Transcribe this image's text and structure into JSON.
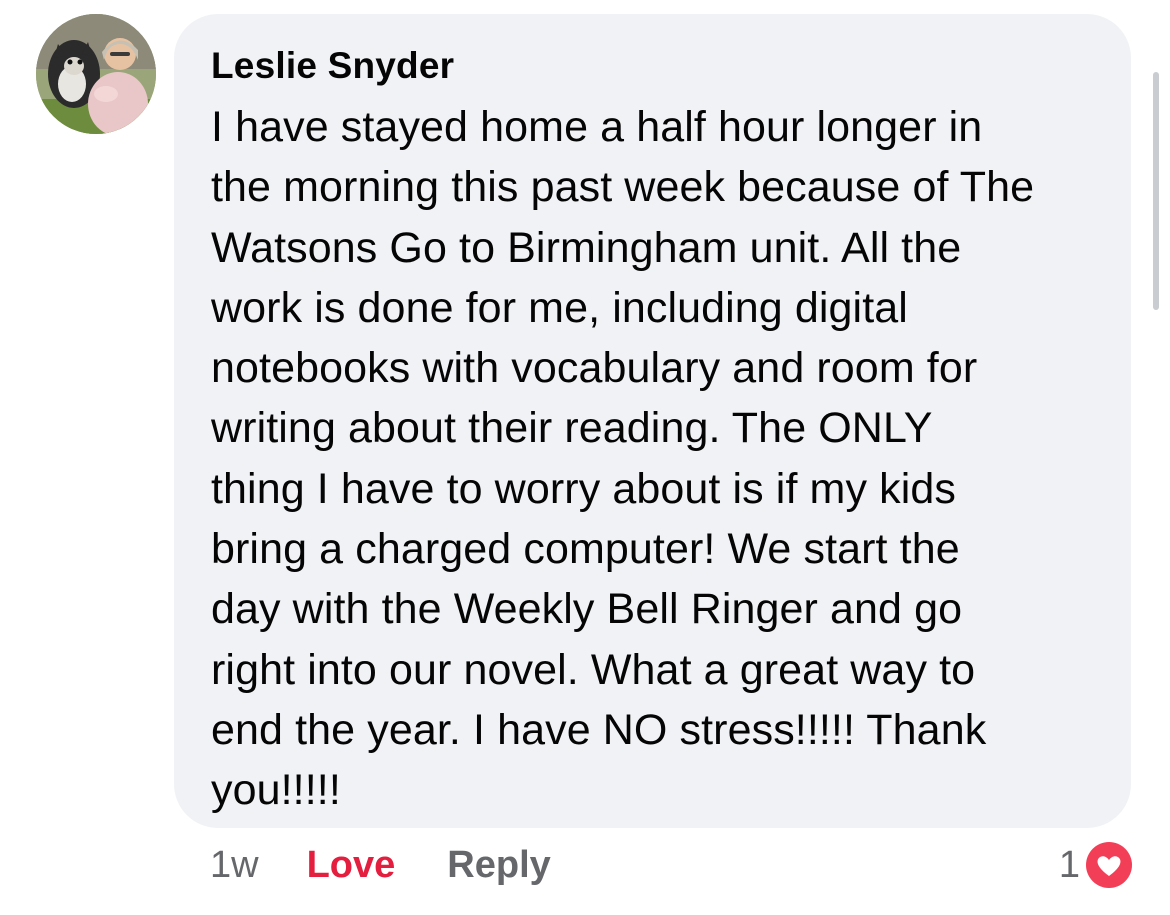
{
  "comment": {
    "author": "Leslie Snyder",
    "text": "I have stayed home a half hour longer in\nthe morning this past week because of The\nWatsons Go to Birmingham unit.   All the\nwork is done for me, including digital\nnotebooks with vocabulary and room for\nwriting about their reading.  The ONLY\nthing I have to worry about is if my kids\nbring a charged computer!  We start the\nday with the Weekly Bell Ringer and go\nright into our novel.   What a great way to\nend the year.  I have NO stress!!!!! Thank\nyou!!!!!"
  },
  "actions": {
    "time": "1w",
    "love_label": "Love",
    "reply_label": "Reply"
  },
  "reactions": {
    "count": "1",
    "icon": "heart-icon"
  },
  "colors": {
    "bubble": "#f0f2f5",
    "love": "#e41e3f",
    "muted": "#65676b",
    "heart": "#f33e58"
  }
}
